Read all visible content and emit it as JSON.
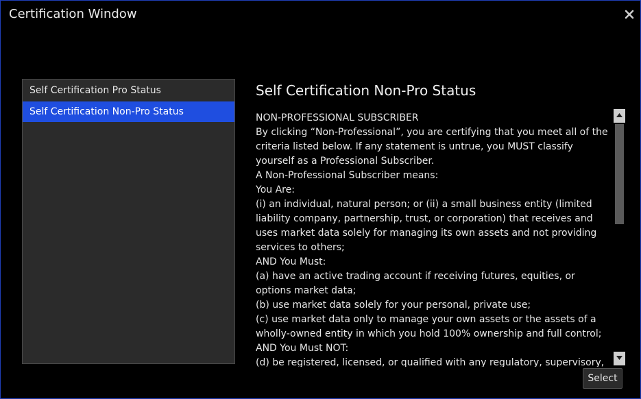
{
  "window": {
    "title": "Certification Window",
    "close_icon": "close-icon",
    "border_color": "#1f3fb8"
  },
  "list": {
    "items": [
      {
        "label": "Self Certification Pro Status",
        "selected": false
      },
      {
        "label": "Self Certification Non-Pro Status",
        "selected": true
      }
    ],
    "selected_color": "#1f4ee0"
  },
  "detail": {
    "heading": "Self Certification Non-Pro Status",
    "paragraphs": [
      "NON-PROFESSIONAL SUBSCRIBER",
      "By clicking “Non-Professional”, you are certifying that you meet all of the criteria listed below. If any statement is untrue, you MUST classify yourself as a Professional Subscriber.",
      "A Non-Professional Subscriber means:",
      "You Are:",
      "(i) an individual, natural person; or (ii) a small business entity (limited liability company, partnership, trust, or corporation) that receives and uses market data solely for managing its own assets and not providing services to others;",
      "AND You Must:",
      "(a) have an active trading account if receiving futures, equities, or options market data;",
      "(b) use market data solely for your personal, private use;",
      "(c) use market data only to manage your own assets or the assets of a wholly-owned entity in which you hold 100% ownership and full control;",
      "AND You Must NOT:",
      "(d) be registered, licensed, or qualified with any regulatory, supervisory,"
    ]
  },
  "scrollbar": {
    "up_icon": "arrow-up-icon",
    "down_icon": "arrow-down-icon"
  },
  "actions": {
    "select_label": "Select"
  }
}
